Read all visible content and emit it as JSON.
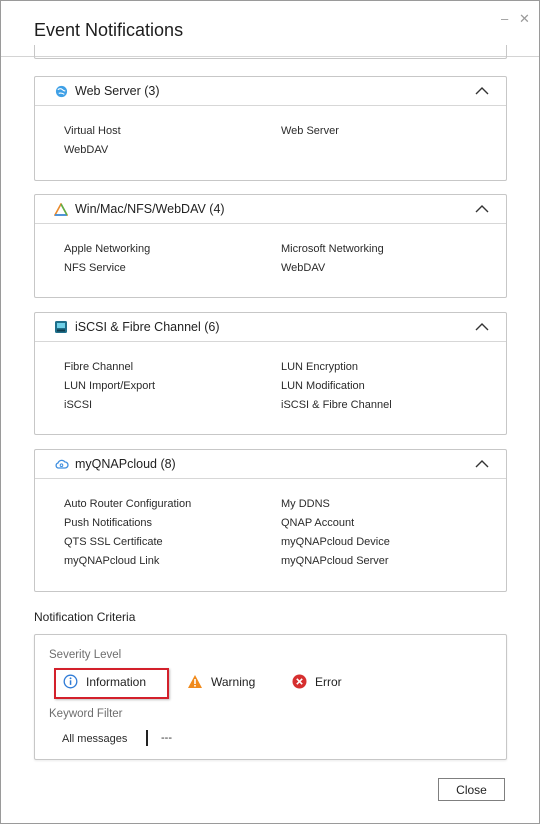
{
  "dialog": {
    "title": "Event Notifications",
    "minimize_glyph": "–",
    "close_glyph": "✕"
  },
  "panels": [
    {
      "title": "Web Server (3)",
      "icon": "globe-icon",
      "items": [
        "Virtual Host",
        "Web Server",
        "WebDAV"
      ]
    },
    {
      "title": "Win/Mac/NFS/WebDAV (4)",
      "icon": "triangle-network-icon",
      "items": [
        "Apple Networking",
        "Microsoft Networking",
        "NFS Service",
        "WebDAV"
      ]
    },
    {
      "title": "iSCSI & Fibre Channel (6)",
      "icon": "storage-device-icon",
      "items": [
        "Fibre Channel",
        "LUN Encryption",
        "LUN Import/Export",
        "LUN Modification",
        "iSCSI",
        "iSCSI & Fibre Channel"
      ]
    },
    {
      "title": "myQNAPcloud (8)",
      "icon": "cloud-icon",
      "items": [
        "Auto Router Configuration",
        "My DDNS",
        "Push Notifications",
        "QNAP Account",
        "QTS SSL Certificate",
        "myQNAPcloud Device",
        "myQNAPcloud Link",
        "myQNAPcloud Server"
      ]
    }
  ],
  "criteria": {
    "section_title": "Notification Criteria",
    "severity_label": "Severity Level",
    "severities": [
      {
        "label": "Information",
        "icon": "info-icon",
        "color": "#2f7bd6",
        "highlighted": true
      },
      {
        "label": "Warning",
        "icon": "warning-icon",
        "color": "#f08a1c",
        "highlighted": false
      },
      {
        "label": "Error",
        "icon": "error-icon",
        "color": "#d62f2f",
        "highlighted": false
      }
    ],
    "keyword_label": "Keyword Filter",
    "keyword_value": "All messages",
    "keyword_secondary": "---"
  },
  "buttons": {
    "close_label": "Close"
  }
}
